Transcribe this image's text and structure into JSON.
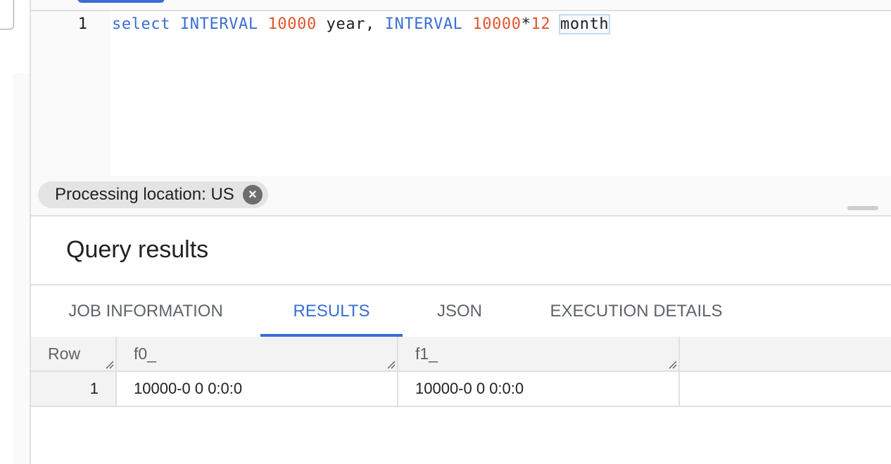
{
  "editor": {
    "line_number": "1",
    "tokens": {
      "t1": "select",
      "t2": "INTERVAL",
      "t3": "10000",
      "t4": "year,",
      "t5": "INTERVAL",
      "t6": "10000",
      "t7": "*",
      "t8": "12",
      "t9": "month"
    }
  },
  "location_chip": {
    "label": "Processing location: US",
    "close_icon": "close-circle-icon"
  },
  "results": {
    "title": "Query results",
    "tabs": [
      {
        "label": "JOB INFORMATION",
        "active": false
      },
      {
        "label": "RESULTS",
        "active": true
      },
      {
        "label": "JSON",
        "active": false
      },
      {
        "label": "EXECUTION DETAILS",
        "active": false
      }
    ],
    "columns": [
      "Row",
      "f0_",
      "f1_"
    ],
    "rows": [
      {
        "row": "1",
        "f0_": "10000-0 0 0:0:0",
        "f1_": "10000-0 0 0:0:0"
      }
    ]
  },
  "colors": {
    "accent": "#3b6ed6",
    "keyword": "#3b6ed6",
    "number": "#e0552b"
  }
}
